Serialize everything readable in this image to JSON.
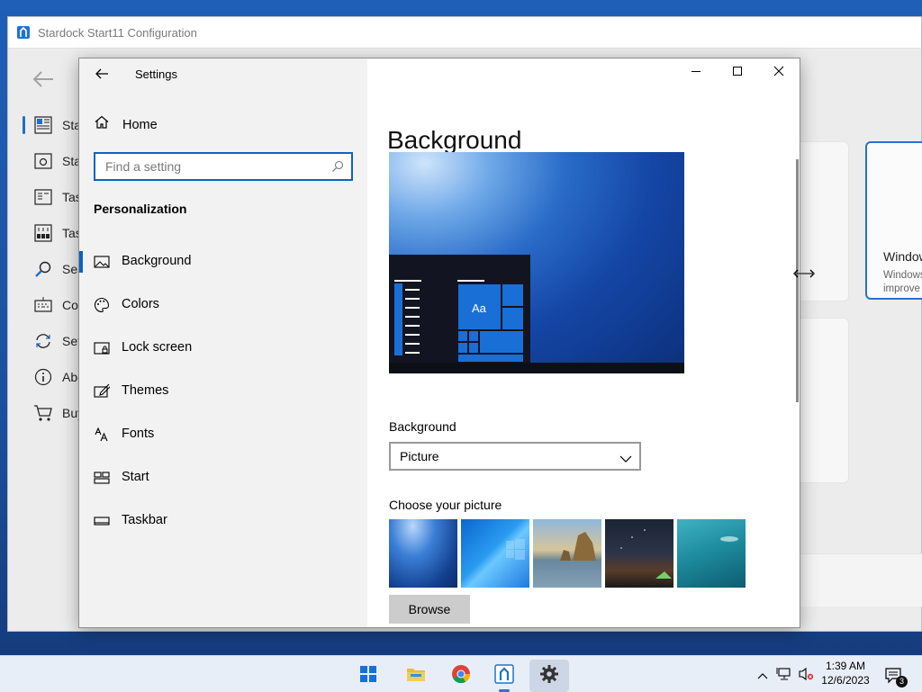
{
  "stardock": {
    "title": "Stardock Start11 Configuration",
    "nav": [
      {
        "label": "Start menu",
        "icon": "start-menu-icon",
        "selected": true
      },
      {
        "label": "Start button",
        "icon": "start-button-icon",
        "selected": false
      },
      {
        "label": "Taskbar",
        "icon": "taskbar-icon",
        "selected": false
      },
      {
        "label": "Taskbar tweaks",
        "icon": "taskbar-tweaks-icon",
        "selected": false
      },
      {
        "label": "Search",
        "icon": "search-icon",
        "selected": false
      },
      {
        "label": "Control",
        "icon": "keyboard-icon",
        "selected": false
      },
      {
        "label": "Settings",
        "icon": "sync-icon",
        "selected": false
      },
      {
        "label": "About",
        "icon": "info-icon",
        "selected": false
      },
      {
        "label": "Buy",
        "icon": "cart-icon",
        "selected": false
      }
    ],
    "selected_card": {
      "title": "Windows",
      "desc_line1": "Windows",
      "desc_line2": "improve"
    }
  },
  "settings": {
    "app_title": "Settings",
    "home_label": "Home",
    "search_placeholder": "Find a setting",
    "section_title": "Personalization",
    "nav": [
      {
        "label": "Background",
        "icon": "picture-icon",
        "selected": true
      },
      {
        "label": "Colors",
        "icon": "palette-icon",
        "selected": false
      },
      {
        "label": "Lock screen",
        "icon": "lock-screen-icon",
        "selected": false
      },
      {
        "label": "Themes",
        "icon": "themes-brush-icon",
        "selected": false
      },
      {
        "label": "Fonts",
        "icon": "fonts-icon",
        "selected": false
      },
      {
        "label": "Start",
        "icon": "start-tiles-icon",
        "selected": false
      },
      {
        "label": "Taskbar",
        "icon": "taskbar-icon",
        "selected": false
      }
    ],
    "page_title": "Background",
    "preview_tile_text": "Aa",
    "background_label": "Background",
    "background_value": "Picture",
    "choose_label": "Choose your picture",
    "browse_label": "Browse",
    "accent": "#0b63c4"
  },
  "taskbar": {
    "time": "1:39 AM",
    "date": "12/6/2023",
    "notification_count": "3"
  }
}
